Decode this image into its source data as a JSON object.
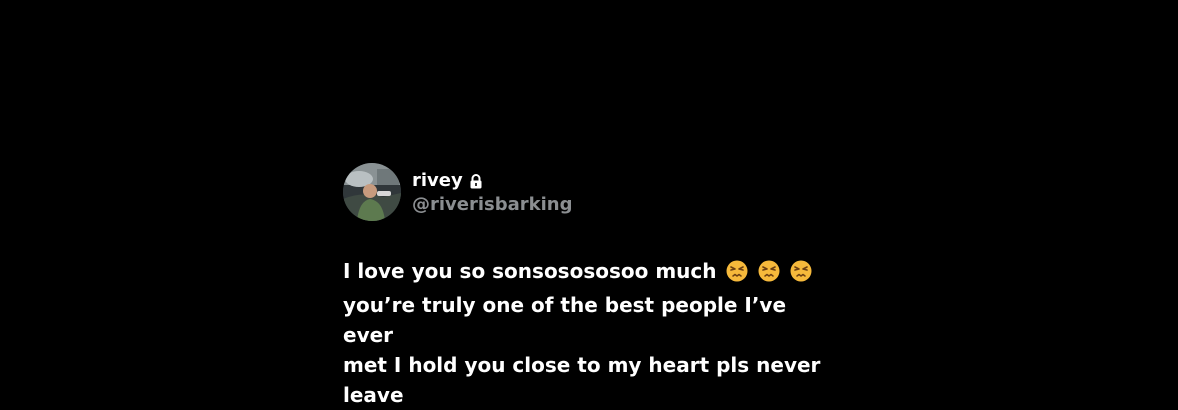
{
  "tweet": {
    "display_name": "rivey",
    "handle": "@riverisbarking",
    "text_lines": [
      "I love you so sonsosososoo much",
      "you’re truly one of the best people I’ve ever",
      "met I hold you close to my heart pls never",
      "leave"
    ],
    "emojis": [
      "persevering-face",
      "persevering-face",
      "persevering-face"
    ]
  },
  "icons": {
    "lock": "lock-icon",
    "avatar": "avatar"
  },
  "colors": {
    "background": "#000000",
    "text": "#ffffff",
    "handle": "#8b8e91",
    "emoji": "#f6b93b"
  }
}
